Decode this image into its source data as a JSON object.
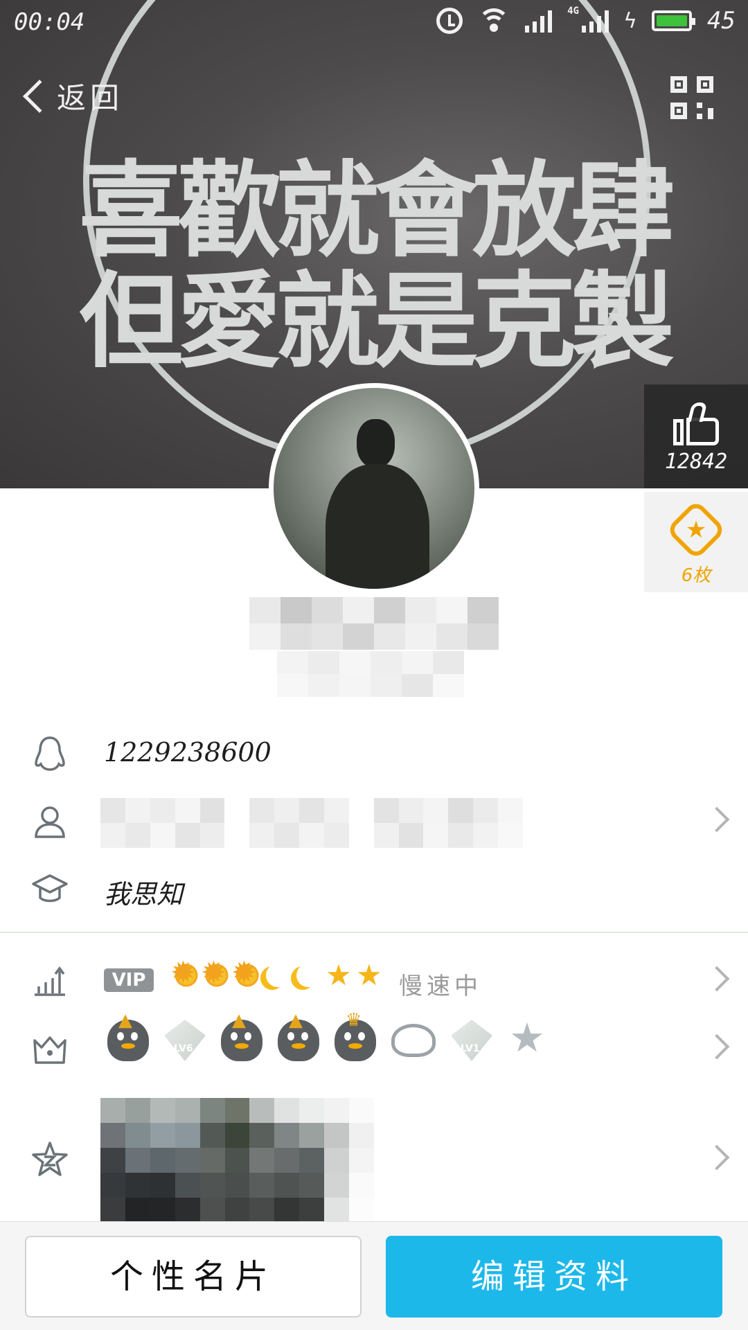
{
  "status_bar": {
    "time": "00:04",
    "network": "4G",
    "battery_level": "45",
    "battery_color": "#3ec13b"
  },
  "nav": {
    "back_label": "返回",
    "qr_icon": "qr-code-icon"
  },
  "cover": {
    "line1": "喜歡就會放肆",
    "line2": "但愛就是克製"
  },
  "likes": {
    "count": "12842",
    "icon": "thumbs-up-icon"
  },
  "medals": {
    "count": "6枚",
    "icon": "medal-icon",
    "color": "#f0a400"
  },
  "profile": {
    "qq_number": "1229238600",
    "school": "我思知",
    "vip_badge": "VIP",
    "level_icons": [
      "sun",
      "sun",
      "sun",
      "moon",
      "moon",
      "star",
      "star"
    ],
    "level_status": "慢速中",
    "badge_labels": {
      "diamond1": "LV6",
      "diamond2": "LV1"
    }
  },
  "buttons": {
    "card_label": "个性名片",
    "edit_label": "编辑资料",
    "edit_color": "#1db8ea"
  }
}
